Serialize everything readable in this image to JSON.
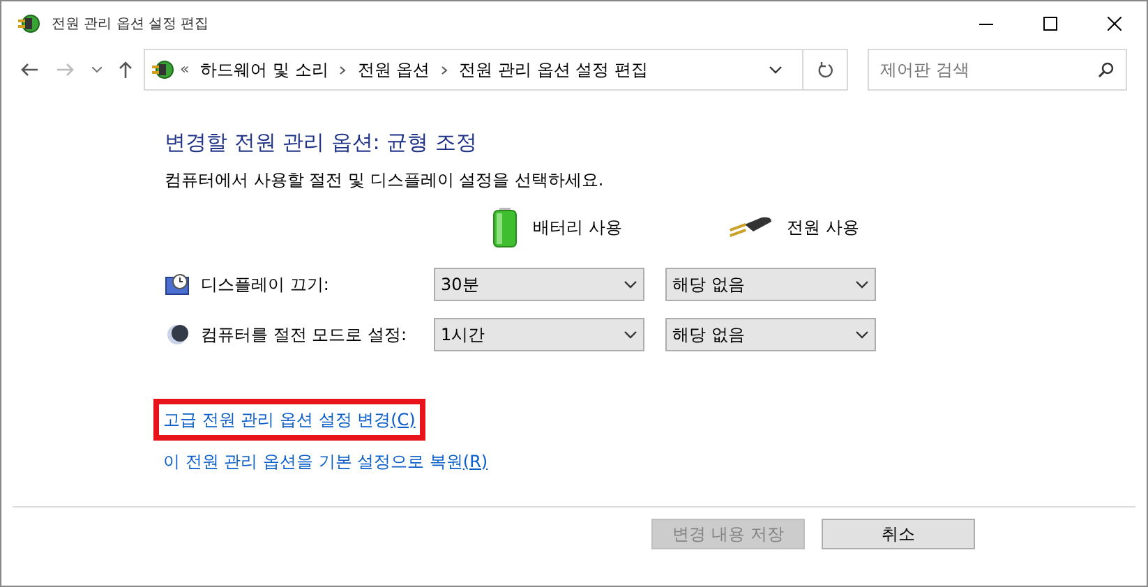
{
  "window": {
    "title": "전원 관리 옵션 설정 편집"
  },
  "address_bar": {
    "prefix": "«",
    "crumbs": [
      "하드웨어 및 소리",
      "전원 옵션",
      "전원 관리 옵션 설정 편집"
    ]
  },
  "search": {
    "placeholder": "제어판 검색"
  },
  "heading": "변경할 전원 관리 옵션: 균형 조정",
  "subheading": "컴퓨터에서 사용할 절전 및 디스플레이 설정을 선택하세요.",
  "columns": [
    {
      "kind": "battery",
      "label": "배터리 사용"
    },
    {
      "kind": "plug",
      "label": "전원 사용"
    }
  ],
  "settings": [
    {
      "kind": "display",
      "label": "디스플레이 끄기:",
      "values": [
        "30분",
        "해당 없음"
      ]
    },
    {
      "kind": "sleep",
      "label": "컴퓨터를 절전 모드로 설정:",
      "values": [
        "1시간",
        "해당 없음"
      ]
    }
  ],
  "links": [
    {
      "label": "고급 전원 관리 옵션 설정 변경",
      "access_key": "(C)",
      "highlighted": true
    },
    {
      "label": "이 전원 관리 옵션을 기본 설정으로 복원",
      "access_key": "(R)",
      "highlighted": false
    }
  ],
  "buttons": [
    {
      "label": "변경 내용 저장",
      "disabled": true
    },
    {
      "label": "취소",
      "disabled": false
    }
  ]
}
